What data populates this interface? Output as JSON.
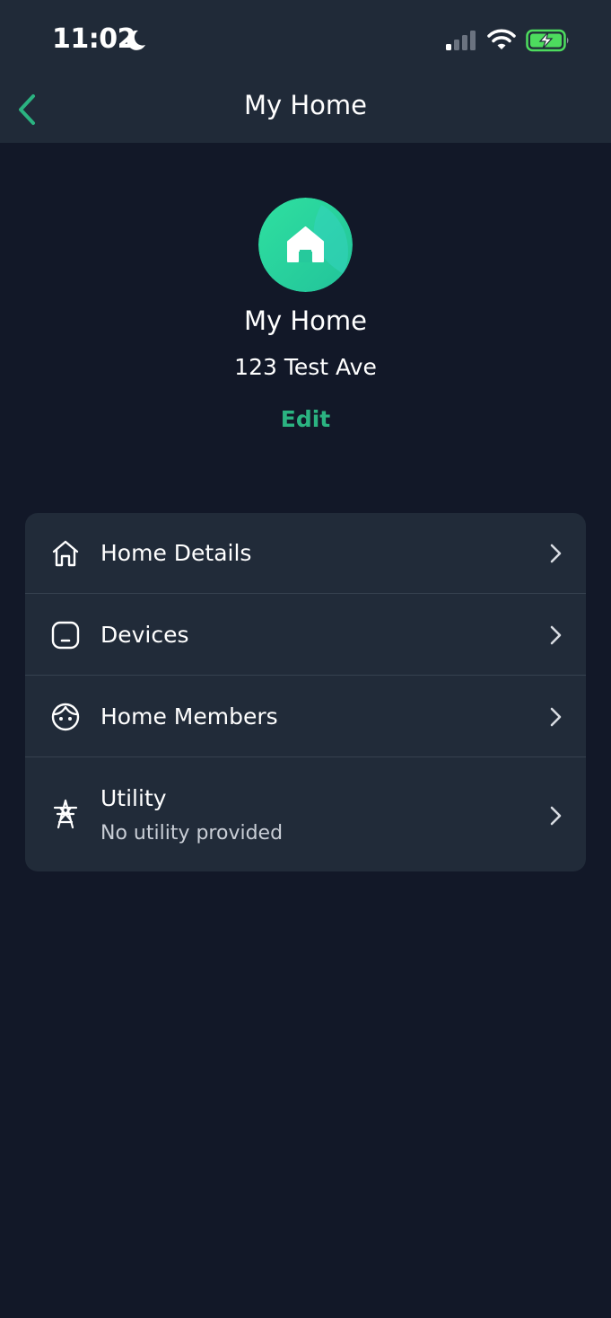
{
  "status_bar": {
    "time": "11:02",
    "icons": [
      "moon-icon",
      "signal-icon",
      "wifi-icon",
      "battery-charging-icon"
    ]
  },
  "nav": {
    "title": "My Home",
    "back_icon": "chevron-left-icon"
  },
  "home": {
    "icon": "house-icon",
    "name": "My Home",
    "address": "123 Test Ave",
    "edit_label": "Edit"
  },
  "menu": {
    "items": [
      {
        "icon": "home-outline-icon",
        "label": "Home Details"
      },
      {
        "icon": "device-icon",
        "label": "Devices"
      },
      {
        "icon": "members-face-icon",
        "label": "Home Members"
      },
      {
        "icon": "utility-tower-icon",
        "label": "Utility",
        "sublabel": "No utility provided"
      }
    ]
  },
  "colors": {
    "background": "#121828",
    "header_bg": "#202a38",
    "card_bg": "#212b39",
    "accent": "#2bb381",
    "battery": "#4ddc5e"
  }
}
